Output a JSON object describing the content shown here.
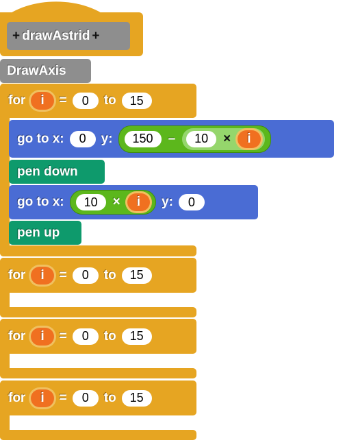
{
  "hat": {
    "name": "drawAstrid",
    "plus": "+"
  },
  "drawaxis": "DrawAxis",
  "kw": {
    "for": "for",
    "eq": "=",
    "to": "to",
    "goto": "go to x:",
    "y": "y:",
    "minus": "–",
    "times": "×",
    "pendown": "pen down",
    "penup": "pen up"
  },
  "loops": [
    {
      "var": "i",
      "from": "0",
      "to": "15"
    },
    {
      "var": "i",
      "from": "0",
      "to": "15"
    },
    {
      "var": "i",
      "from": "0",
      "to": "15"
    },
    {
      "var": "i",
      "from": "0",
      "to": "15"
    }
  ],
  "goto1": {
    "x": "0",
    "a": "150",
    "b": "10",
    "v": "i"
  },
  "goto2": {
    "a": "10",
    "v": "i",
    "y": "0"
  },
  "colors": {
    "control": "#e6a522",
    "motion": "#4a6cd4",
    "pen": "#0e9a6c",
    "operators": "#5cb71c",
    "variable": "#f07020",
    "custom": "#8e8e8e"
  }
}
